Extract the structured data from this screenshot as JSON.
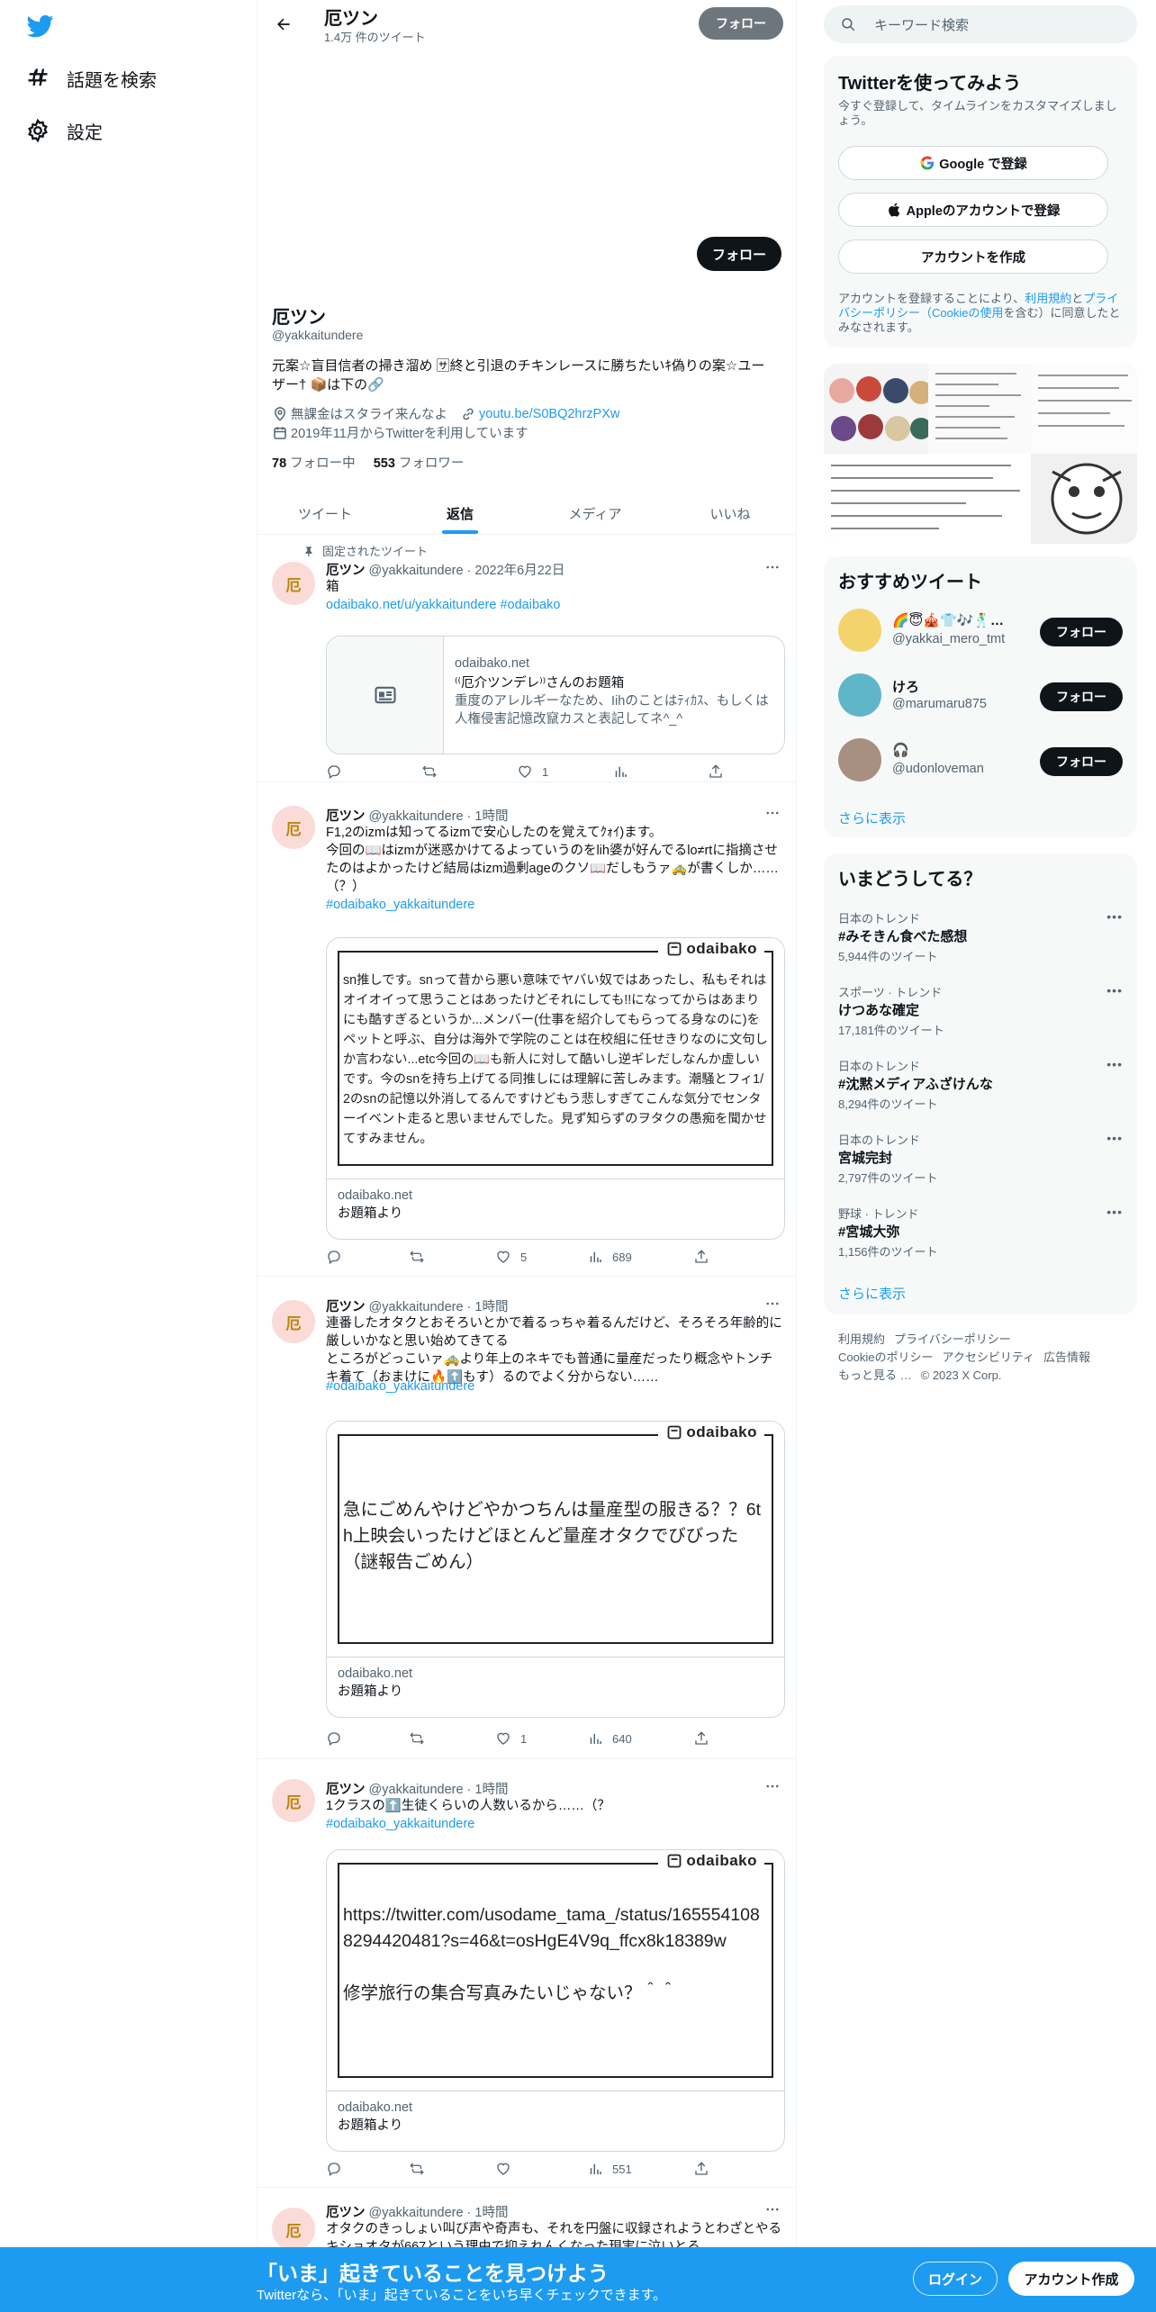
{
  "nav": {
    "explore_label": "話題を検索",
    "settings_label": "設定"
  },
  "header": {
    "name": "厄ツン",
    "tweet_count": "1.4万 件のツイート",
    "follow_label": "フォロー"
  },
  "profile": {
    "follow_label": "フォロー",
    "name": "厄ツン",
    "handle": "@yakkaitundere",
    "bio_line1": "元案☆盲目信者の掃き溜め 🈂終と引退のチキンレースに勝ちたいｷ偽りの案☆ユー",
    "bio_line2": "ザー† 📦は下の🔗",
    "location": "無課金はスタライ来んなよ",
    "link": "youtu.be/S0BQ2hrzPXw",
    "joined": "2019年11月からTwitterを利用しています",
    "following_count": "78",
    "following_label": "フォロー中",
    "followers_count": "553",
    "followers_label": "フォロワー"
  },
  "tabs": [
    {
      "label": "ツイート"
    },
    {
      "label": "返信"
    },
    {
      "label": "メディア"
    },
    {
      "label": "いいね"
    }
  ],
  "tweets": [
    {
      "pinned_label": "固定されたツイート",
      "name": "厄ツン",
      "handle_time": "@yakkaitundere · 2022年6月22日",
      "text": "箱",
      "link_text": "odaibako.net/u/yakkaitundere #odaibako",
      "card_domain": "odaibako.net",
      "card_title": "⁽⁽厄介ツンデレ⁾⁾さんのお題箱",
      "card_desc": "重度のアレルギーなため、Iihのことはﾃｨｶｽ、もしくは人権侵害記憶改竄カスと表記してネ^_^",
      "likes": "1"
    },
    {
      "name": "厄ツン",
      "handle_time": "@yakkaitundere · 1時間",
      "text": "F1,2のizmは知ってるizmで安心したのを覚えてｸｫｲ)ます。\n今回の📖はizmが迷惑かけてるよっていうのをlih婆が好んでるlo≠rtに指摘させたのはよかったけど結局はizm過剰ageのクソ📖だしもうァ🚕が書くしか……（？）",
      "hashtag": "#odaibako_yakkaitundere",
      "image_text": "sn推しです。snって昔から悪い意味でヤバい奴ではあったし、私もそれはオイオイって思うことはあったけどそれにしても!!になってからはあまりにも酷すぎるというか...メンバー(仕事を紹介してもらってる身なのに)をペットと呼ぶ、自分は海外で学院のことは在校組に任せきりなのに文句しか言わない...etc今回の📖も新人に対して酷いし逆ギレだしなんか虚しいです。今のsnを持ち上げてる同推しには理解に苦しみます。潮騒とフィ1/2のsnの記憶以外消してるんですけどもう悲しすぎてこんな気分でセンターイベント走ると思いませんでした。見ず知らずのヲタクの愚痴を聞かせてすみません。",
      "logo_text": "odaibako",
      "card_domain": "odaibako.net",
      "card_title": "お題箱より",
      "likes": "5",
      "views": "689"
    },
    {
      "name": "厄ツン",
      "handle_time": "@yakkaitundere · 1時間",
      "text": "連番したオタクとおそろいとかで着るっちゃ着るんだけど、そろそろ年齢的に厳しいかなと思い始めてきてる\nところがどっこいァ🚕より年上のネキでも普通に量産だったり概念やトンチキ着て（おまけに🔥⬆️もす）るのでよく分からない……",
      "hashtag": "#odaibako_yakkaitundere",
      "image_text": "急にごめんやけどやかつちんは量産型の服きる？？6th上映会いったけどほとんど量産オタクでびびった（謎報告ごめん）",
      "logo_text": "odaibako",
      "card_domain": "odaibako.net",
      "card_title": "お題箱より",
      "likes": "1",
      "views": "640"
    },
    {
      "name": "厄ツン",
      "handle_time": "@yakkaitundere · 1時間",
      "text": "1クラスの⬆️生徒くらいの人数いるから……（？",
      "hashtag": "#odaibako_yakkaitundere",
      "image_text": "https://twitter.com/usodame_tama_/status/1655541088294420481?s=46&t=osHgE4V9q_ffcx8k18389w\n\n修学旅行の集合写真みたいじゃない？＾＾",
      "logo_text": "odaibako",
      "card_domain": "odaibako.net",
      "card_title": "お題箱より",
      "likes": "",
      "views": "551"
    },
    {
      "name": "厄ツン",
      "handle_time": "@yakkaitundere · 1時間",
      "text": "オタクのきっしょい叫び声や奇声も、それを円盤に収録されようとわざとやるキショオタが667という理由で抑えれんくなった現実に泣いとる"
    }
  ],
  "right": {
    "search_placeholder": "キーワード検索",
    "signup_title": "Twitterを使ってみよう",
    "signup_sub": "今すぐ登録して、タイムラインをカスタマイズしましょう。",
    "google_label": "Google で登録",
    "apple_label": "Appleのアカウントで登録",
    "create_label": "アカウントを作成",
    "legal_prefix": "アカウントを登録することにより、",
    "legal_terms": "利用規約",
    "legal_and": "と",
    "legal_privacy": "プライバシーポリシー（Cookieの使用",
    "legal_suffix": "を含む）に同意したとみなされます。",
    "rec_title": "おすすめツイート",
    "recs": [
      {
        "name": "🌈😇🎪👕🎶🕺…",
        "handle": "@yakkai_mero_tmt",
        "button": "フォロー",
        "color": "#f3d36b"
      },
      {
        "name": "けろ",
        "handle": "@marumaru875",
        "button": "フォロー",
        "color": "#5fb6c8"
      },
      {
        "name": "🎧",
        "handle": "@udonloveman",
        "button": "フォロー",
        "color": "#a89080"
      }
    ],
    "show_more": "さらに表示",
    "trend_title": "いまどうしてる？",
    "trends": [
      {
        "category": "日本のトレンド",
        "name": "#みそきん食べた感想",
        "count": "5,944件のツイート"
      },
      {
        "category": "スポーツ · トレンド",
        "name": "けつあな確定",
        "count": "17,181件のツイート"
      },
      {
        "category": "日本のトレンド",
        "name": "#沈黙メディアふざけんな",
        "count": "8,294件のツイート"
      },
      {
        "category": "日本のトレンド",
        "name": "宮城完封",
        "count": "2,797件のツイート"
      },
      {
        "category": "野球 · トレンド",
        "name": "#宮城大弥",
        "count": "1,156件のツイート"
      }
    ],
    "trend_show_more": "さらに表示",
    "footer": {
      "terms": "利用規約",
      "privacy": "プライバシーポリシー",
      "cookies": "Cookieのポリシー",
      "accessibility": "アクセシビリティ",
      "ads": "広告情報",
      "more": "もっと見る …",
      "copyright": "© 2023 X Corp."
    }
  },
  "bottom": {
    "title": "「いま」起きていることを見つけよう",
    "subtitle": "Twitterなら、「いま」起きていることをいち早くチェックできます。",
    "login": "ログイン",
    "signup": "アカウント作成"
  },
  "colors": {
    "accent": "#1d9bf0",
    "bottom_bar": "#1d9bf0"
  }
}
